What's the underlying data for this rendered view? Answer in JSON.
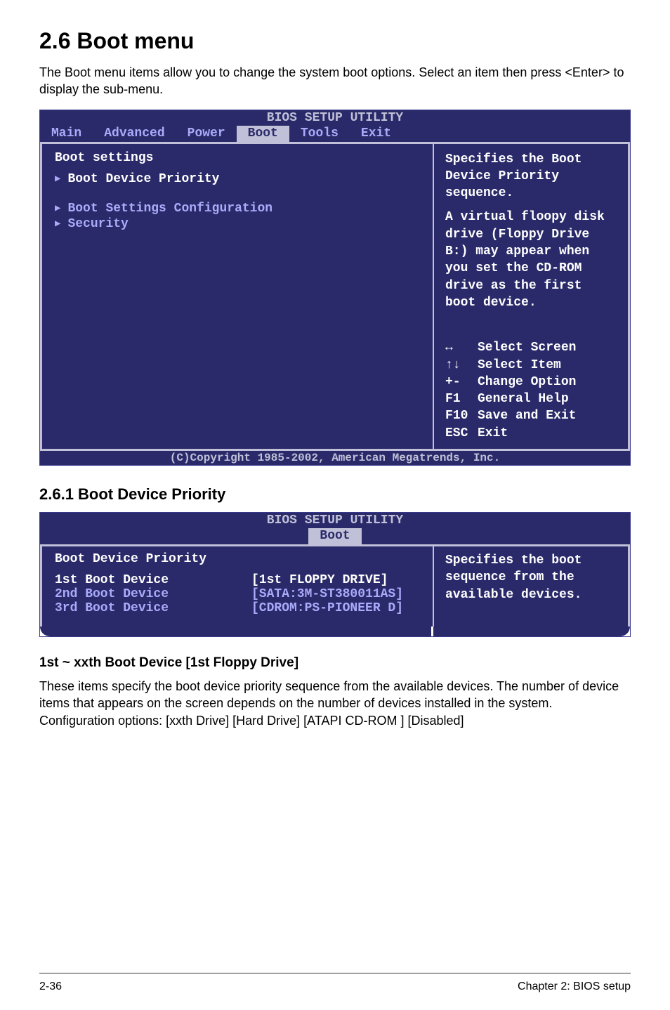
{
  "section": {
    "number_title": "2.6    Boot menu",
    "description": "The Boot menu items allow you to change the system boot options. Select an item then press <Enter> to display the sub-menu."
  },
  "bios1": {
    "header": "BIOS SETUP UTILITY",
    "tabs": [
      "Main",
      "Advanced",
      "Power",
      "Boot",
      "Tools",
      "Exit"
    ],
    "active_tab": "Boot",
    "left": {
      "group_title": "Boot settings",
      "items": [
        {
          "label": "Boot Device Priority",
          "selected": true
        },
        {
          "label": "Boot Settings Configuration",
          "selected": false
        },
        {
          "label": "Security",
          "selected": false
        }
      ]
    },
    "right": {
      "help_lines": [
        "Specifies the Boot Device Priority sequence.",
        "A virtual floopy disk drive (Floppy Drive B:) may appear when you set the CD-ROM drive as the first boot device."
      ],
      "keys": [
        {
          "k": "↔",
          "v": "Select Screen"
        },
        {
          "k": "↑↓",
          "v": "Select Item"
        },
        {
          "k": "+-",
          "v": "Change Option"
        },
        {
          "k": "F1",
          "v": "General Help"
        },
        {
          "k": "F10",
          "v": "Save and Exit"
        },
        {
          "k": "ESC",
          "v": "Exit"
        }
      ]
    },
    "footer": "(C)Copyright 1985-2002, American Megatrends, Inc."
  },
  "subsection": {
    "title": "2.6.1     Boot Device Priority"
  },
  "bios2": {
    "header": "BIOS SETUP UTILITY",
    "tabs": [
      "Boot"
    ],
    "left": {
      "group_title": "Boot Device Priority",
      "rows": [
        {
          "name": "1st Boot Device",
          "value": "[1st FLOPPY DRIVE]",
          "selected": true
        },
        {
          "name": "2nd Boot Device",
          "value": "[SATA:3M-ST380011AS]",
          "selected": false
        },
        {
          "name": "3rd Boot Device",
          "value": "[CDROM:PS-PIONEER D]",
          "selected": false
        }
      ]
    },
    "right": {
      "help": "Specifies the boot sequence from the available devices."
    }
  },
  "sub_heading": "1st ~ xxth Boot Device [1st Floppy Drive]",
  "body_paragraph": "These items specify the boot device priority sequence from the available devices. The number of device items that appears on the screen depends on the number of devices installed in the system. Configuration options: [xxth Drive] [Hard Drive] [ATAPI CD-ROM  ] [Disabled]",
  "footer": {
    "left": "2-36",
    "right": "Chapter 2: BIOS setup"
  }
}
